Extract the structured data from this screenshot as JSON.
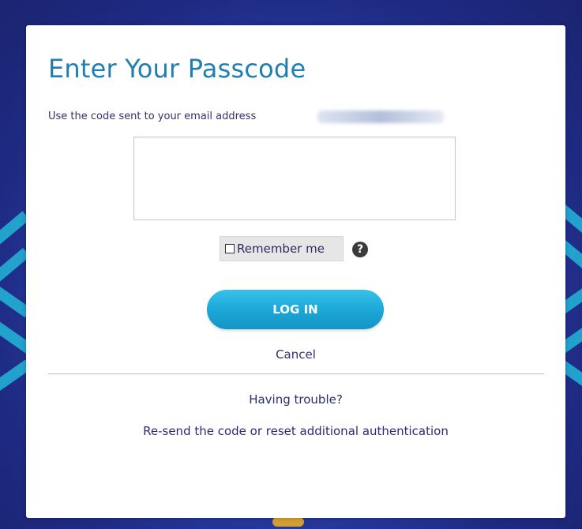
{
  "login": {
    "title": "Enter Your Passcode",
    "instruction": "Use the code sent to your email address",
    "code_value": "",
    "remember_label": "Remember me",
    "remember_checked": false,
    "login_label": "LOG IN",
    "cancel_label": "Cancel",
    "trouble_text": "Having trouble?",
    "resend_label": "Re-send the code or reset additional authentication"
  },
  "icons": {
    "help": "?"
  },
  "colors": {
    "title": "#1f7fb0",
    "button": "#1aa6d7",
    "background": "#2a3ea8",
    "accent_stripes": "#22b6d8"
  }
}
